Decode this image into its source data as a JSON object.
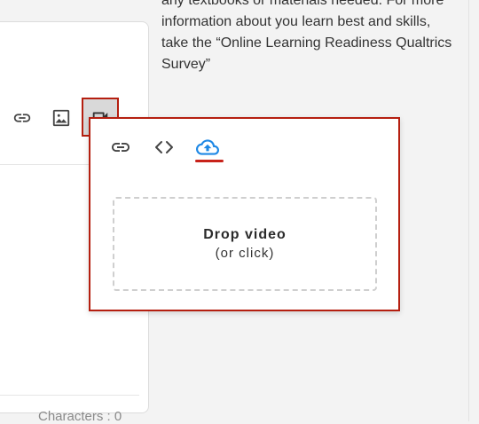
{
  "editor": {
    "character_count": "Characters : 0"
  },
  "right_panel": {
    "text_lines": [
      "any textbooks or materials needed. For more",
      "information about you learn best and skills,",
      "take the “Online Learning Readiness Qualtrics",
      "Survey”"
    ]
  },
  "video_popup": {
    "tabs": [
      "link-icon",
      "embed-code-icon",
      "upload-cloud-icon"
    ],
    "active_tab": "upload-cloud-icon",
    "dropzone_title": "Drop video",
    "dropzone_subtitle": "(or click)"
  },
  "colors": {
    "highlight_border": "#b51f10",
    "active_tab": "#1e88e5",
    "tab_underline": "#c8221a"
  }
}
